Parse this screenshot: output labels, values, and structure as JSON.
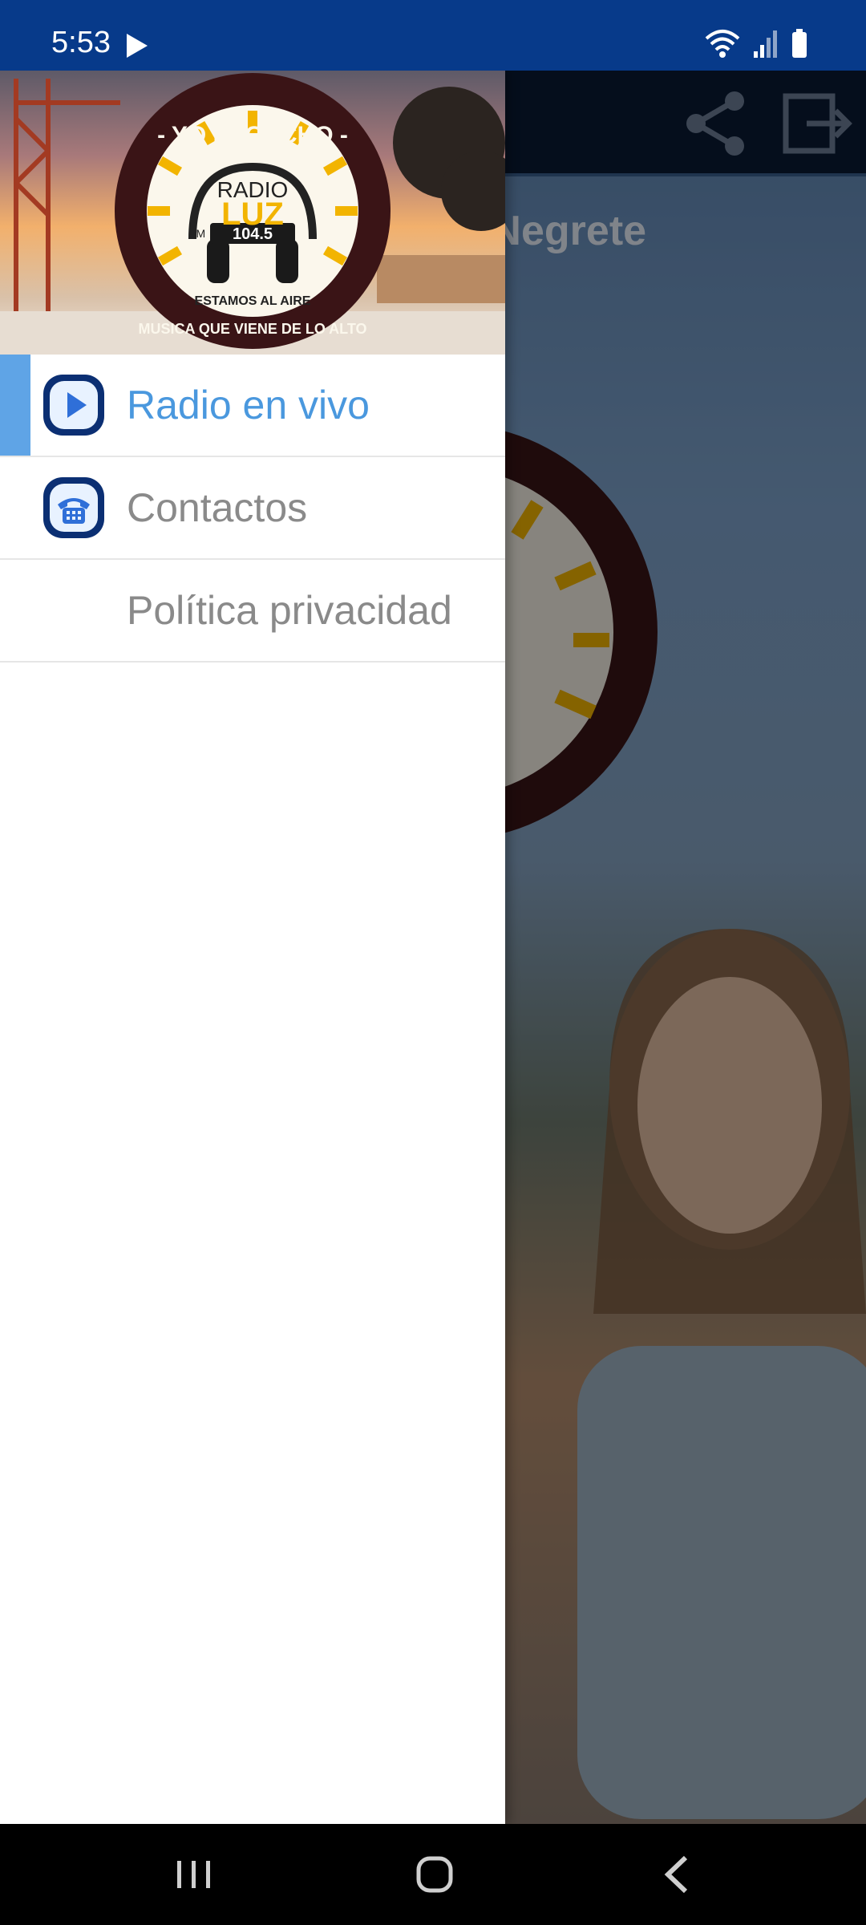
{
  "status_bar": {
    "time": "5:53",
    "icons": [
      "play-icon",
      "wifi-icon",
      "signal-icon",
      "battery-icon"
    ]
  },
  "background_app": {
    "title_partial": "olo Negrete",
    "toolbar_icons": [
      "share-icon",
      "exit-icon"
    ]
  },
  "drawer": {
    "header_logo": {
      "top_arc": "- YO ESCUCHO -",
      "bottom_arc": "MUSICA QUE VIENE DE LO ALTO",
      "brand_top": "RADIO",
      "brand_main": "LUZ",
      "band": "FM",
      "frequency": "104.5",
      "tagline": "ESTAMOS AL AIRE"
    },
    "items": [
      {
        "label": "Radio en vivo",
        "icon": "play-icon",
        "active": true
      },
      {
        "label": "Contactos",
        "icon": "phone-icon",
        "active": false
      },
      {
        "label": "Política privacidad",
        "icon": "",
        "active": false
      }
    ]
  },
  "colors": {
    "status_bar": "#073A8A",
    "accent": "#5FA4E6",
    "active_text": "#4A98DE",
    "inactive_text": "#8A8A8A"
  },
  "nav_bar": {
    "buttons": [
      "recent-apps-icon",
      "home-icon",
      "back-icon"
    ]
  }
}
